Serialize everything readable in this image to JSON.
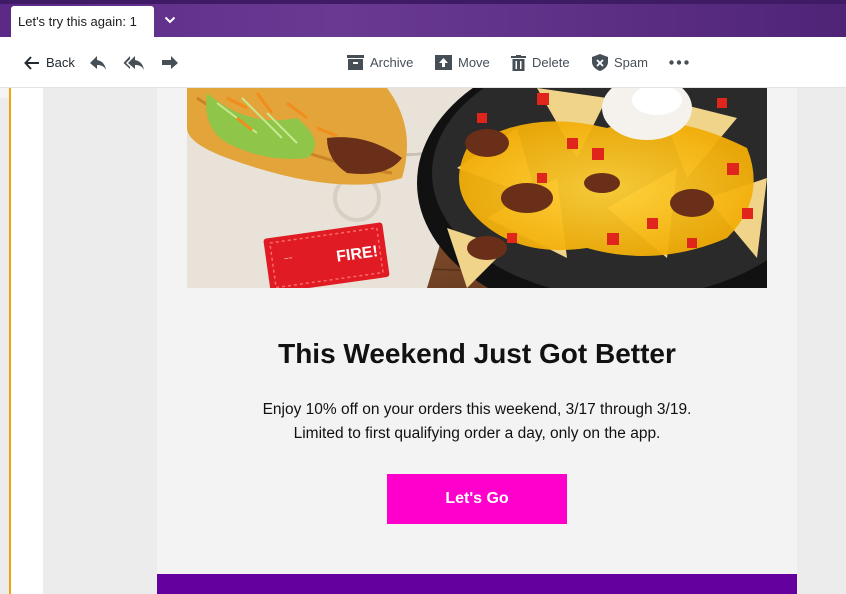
{
  "tab": {
    "title": "Let's try this again: 1"
  },
  "toolbar": {
    "back_label": "Back",
    "archive_label": "Archive",
    "move_label": "Move",
    "delete_label": "Delete",
    "spam_label": "Spam"
  },
  "email": {
    "headline": "This Weekend Just Got Better",
    "body_line1": "Enjoy 10% off on your orders this weekend, 3/17 through 3/19.",
    "body_line2": "Limited to first qualifying order a day, only on the app.",
    "cta_label": "Let's Go",
    "sauce_packet_text": "FIRE!"
  },
  "colors": {
    "tab_bar": "#5b2a86",
    "accent_gutter": "#f0a30a",
    "cta_bg": "#ff00cc",
    "footer_bar": "#64009e"
  },
  "icons": [
    "chevron-down-icon",
    "back-arrow-icon",
    "reply-icon",
    "reply-all-icon",
    "forward-icon",
    "archive-icon",
    "move-icon",
    "delete-icon",
    "spam-icon",
    "more-icon"
  ]
}
